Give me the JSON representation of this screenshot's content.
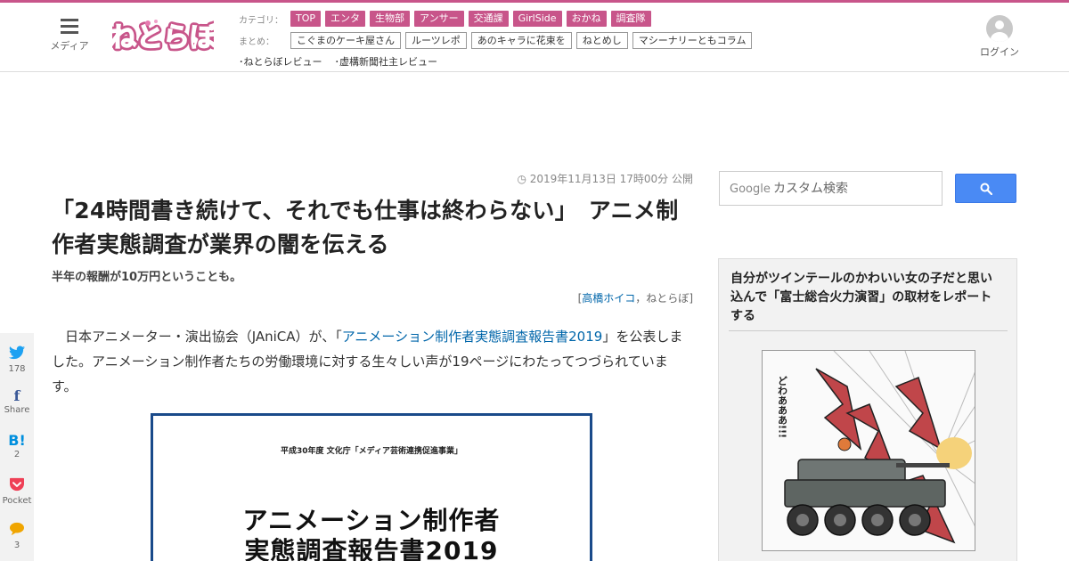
{
  "header": {
    "menu_label": "メディア",
    "logo_text": "ねとらぼ",
    "category_label": "カテゴリ：",
    "categories": [
      "TOP",
      "エンタ",
      "生物部",
      "アンサー",
      "交通課",
      "GirlSide",
      "おかね",
      "調査隊"
    ],
    "matome_label": "まとめ：",
    "matome": [
      "こぐまのケーキ屋さん",
      "ルーツレポ",
      "あのキャラに花束を",
      "ねとめし",
      "マシーナリーともコラム"
    ],
    "reviews": [
      "･ねとらぼレビュー",
      "･虚構新聞社主レビュー"
    ],
    "login_label": "ログイン"
  },
  "share": [
    {
      "icon": "twitter-icon",
      "glyph": "🐦",
      "count": "178"
    },
    {
      "icon": "facebook-icon",
      "glyph": "f",
      "count": "Share"
    },
    {
      "icon": "hatena-icon",
      "glyph": "B!",
      "count": "2"
    },
    {
      "icon": "pocket-icon",
      "glyph": "⌄",
      "count": "Pocket"
    },
    {
      "icon": "comment-icon",
      "glyph": "💬",
      "count": "3"
    }
  ],
  "article": {
    "date": "2019年11月13日 17時00分 公開",
    "title": "「24時間書き続けて、それでも仕事は終わらない」　アニメ制作者実態調査が業界の闇を伝える",
    "subtitle": "半年の報酬が10万円ということも。",
    "author_open": "[",
    "author_name": "高橋ホイコ",
    "author_sep": "，",
    "author_site": "ねとらぼ",
    "author_close": "]",
    "body_pre": "日本アニメーター・演出協会（JAniCA）が、「",
    "body_link": "アニメーション制作者実態調査報告書2019",
    "body_post": "」を公表しました。アニメーション制作者たちの労働環境に対する生々しい声が19ページにわたってつづられています。",
    "doc_small": "平成30年度 文化庁「メディア芸術連携促進事業」",
    "doc_title_1": "アニメーション制作者",
    "doc_title_2": "実態調査報告書2019"
  },
  "sidebar": {
    "search_brand": "Google",
    "search_placeholder": "カスタム検索",
    "card_title": "自分がツインテールのかわいい女の子だと思い込んで「富士総合火力演習」の取材をレポートする",
    "manga_text_1": "どわあああ!!!"
  },
  "colors": {
    "brand_pink": "#c8558a",
    "link_blue": "#0066aa",
    "search_blue": "#4a8af4"
  }
}
